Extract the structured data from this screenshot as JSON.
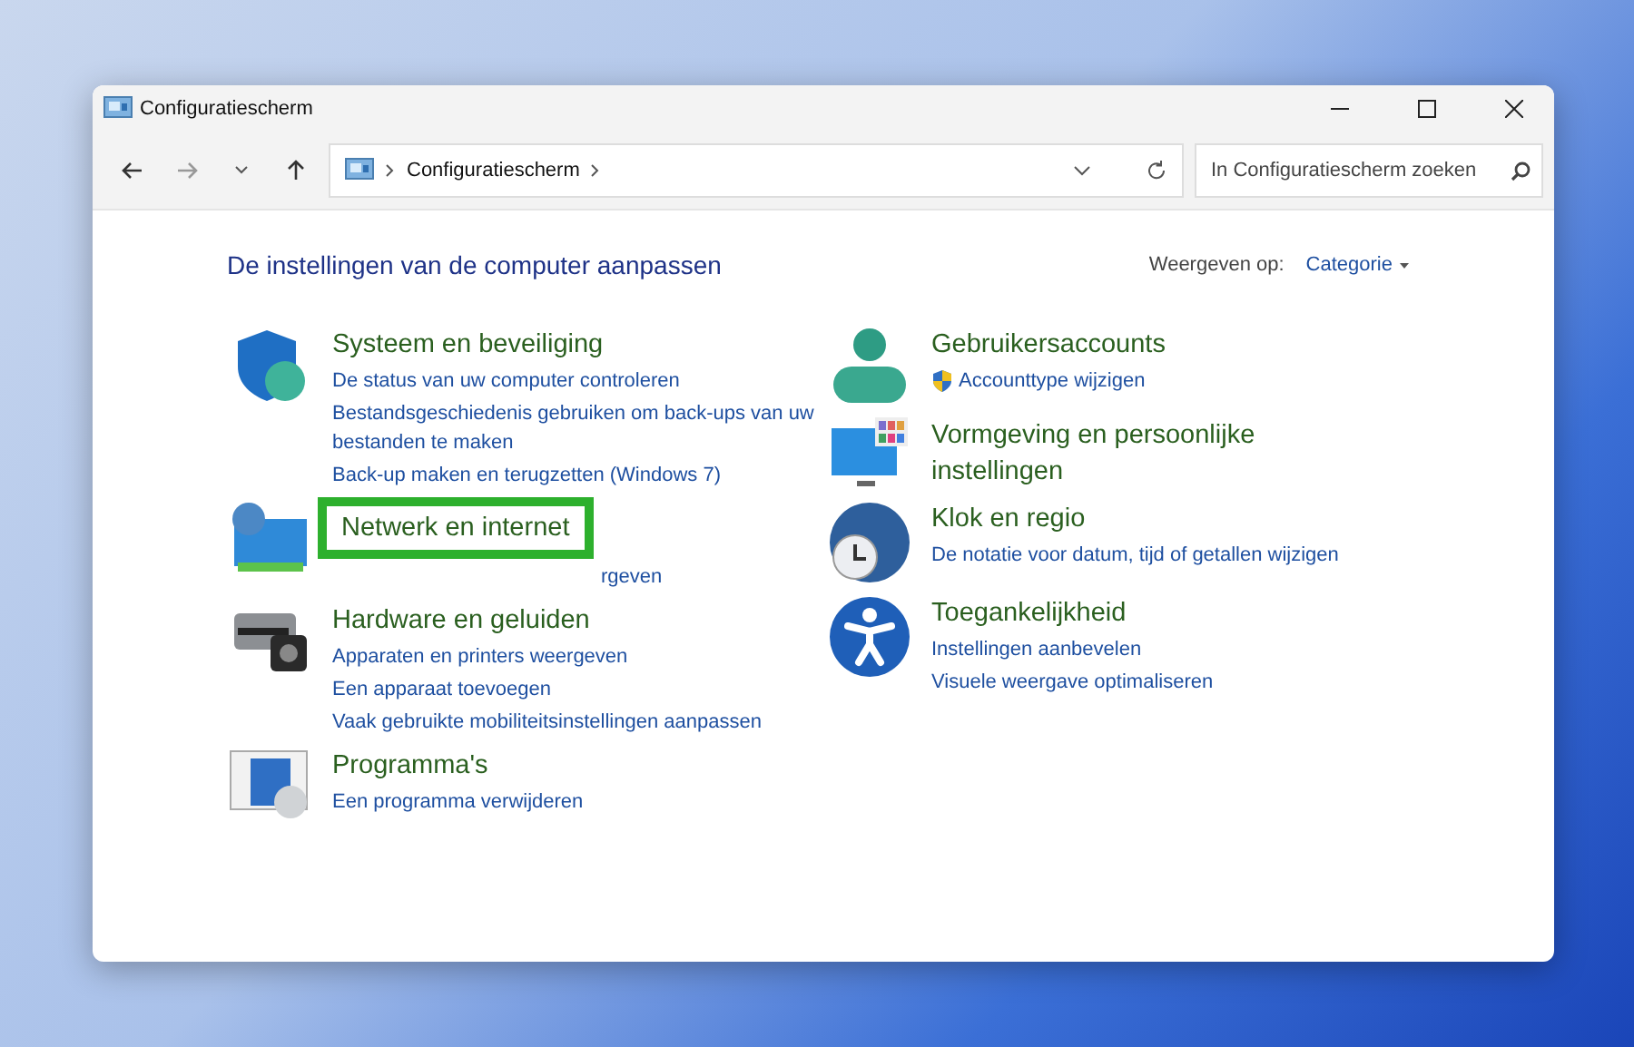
{
  "window": {
    "title": "Configuratiescherm"
  },
  "address_bar": {
    "path": [
      "Configuratiescherm"
    ]
  },
  "search": {
    "placeholder": "In Configuratiescherm zoeken"
  },
  "heading": "De instellingen van de computer aanpassen",
  "view_by": {
    "label": "Weergeven op:",
    "value": "Categorie"
  },
  "columns": [
    {
      "categories": [
        {
          "kind": "security",
          "title": "Systeem en beveiliging",
          "highlighted": false,
          "links": [
            {
              "text": "De status van uw computer controleren",
              "shield": false
            },
            {
              "text": "Bestandsgeschiedenis gebruiken om back-ups van uw bestanden te maken",
              "shield": false
            },
            {
              "text": "Back-up maken en terugzetten (Windows 7)",
              "shield": false
            }
          ]
        },
        {
          "kind": "network",
          "title": "Netwerk en internet",
          "highlighted": true,
          "links": [
            {
              "text": "rgeven",
              "shield": false
            }
          ]
        },
        {
          "kind": "hardware",
          "title": "Hardware en geluiden",
          "highlighted": false,
          "links": [
            {
              "text": "Apparaten en printers weergeven",
              "shield": false
            },
            {
              "text": "Een apparaat toevoegen",
              "shield": false
            },
            {
              "text": "Vaak gebruikte mobiliteitsinstellingen aanpassen",
              "shield": false
            }
          ]
        },
        {
          "kind": "programs",
          "title": "Programma's",
          "highlighted": false,
          "links": [
            {
              "text": "Een programma verwijderen",
              "shield": false
            }
          ]
        }
      ]
    },
    {
      "categories": [
        {
          "kind": "user",
          "title": "Gebruikersaccounts",
          "highlighted": false,
          "links": [
            {
              "text": "Accounttype wijzigen",
              "shield": true
            }
          ]
        },
        {
          "kind": "appearance",
          "title": "Vormgeving en persoonlijke instellingen",
          "highlighted": false
        },
        {
          "kind": "clock",
          "title": "Klok en regio",
          "highlighted": false,
          "links": [
            {
              "text": "De notatie voor datum, tijd of getallen wijzigen",
              "shield": false
            }
          ]
        },
        {
          "kind": "access",
          "title": "Toegankelijkheid",
          "highlighted": false,
          "links": [
            {
              "text": "Instellingen aanbevelen",
              "shield": false
            },
            {
              "text": "Visuele weergave optimaliseren",
              "shield": false
            }
          ]
        }
      ]
    }
  ]
}
